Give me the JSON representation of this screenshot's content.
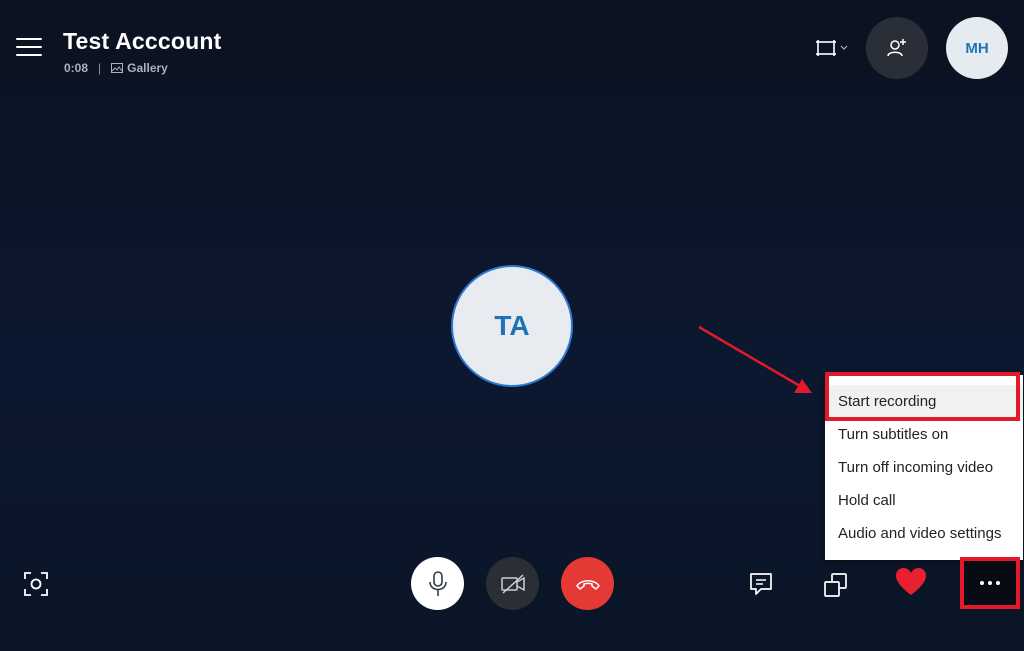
{
  "call": {
    "contact_name": "Test Acccount",
    "duration": "0:08",
    "separator": "|",
    "view_mode": "Gallery"
  },
  "header": {
    "my_initials": "MH"
  },
  "participant": {
    "initials": "TA"
  },
  "more_menu": {
    "items": [
      "Start recording",
      "Turn subtitles on",
      "Turn off incoming video",
      "Hold call",
      "Audio and video settings"
    ]
  },
  "colors": {
    "accent_blue": "#1f73b7",
    "end_call_red": "#e53935",
    "highlight_red": "#e21a2a",
    "heart_red": "#e8202f"
  }
}
